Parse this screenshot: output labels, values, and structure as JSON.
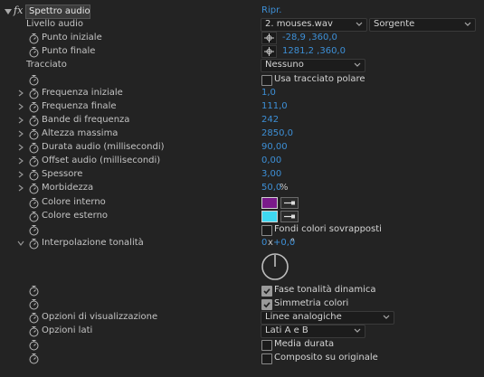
{
  "header": {
    "fx_label": "fx",
    "effect_name": "Spettro audio",
    "reset_label": "Ripr."
  },
  "livello_audio": {
    "label": "Livello audio",
    "layer_value": "2. mouses.wav",
    "source_value": "Sorgente"
  },
  "punto_iniziale": {
    "label": "Punto iniziale",
    "value": "-28,9 ,360,0"
  },
  "punto_finale": {
    "label": "Punto finale",
    "value": "1281,2 ,360,0"
  },
  "tracciato": {
    "label": "Tracciato",
    "value": "Nessuno"
  },
  "usa_tracciato_polare": {
    "label": "Usa tracciato polare",
    "checked": false
  },
  "frequenza_iniziale": {
    "label": "Frequenza iniziale",
    "value": "1,0"
  },
  "frequenza_finale": {
    "label": "Frequenza finale",
    "value": "111,0"
  },
  "bande_di_frequenza": {
    "label": "Bande di frequenza",
    "value": "242"
  },
  "altezza_massima": {
    "label": "Altezza massima",
    "value": "2850,0"
  },
  "durata_audio": {
    "label": "Durata audio (millisecondi)",
    "value": "90,00"
  },
  "offset_audio": {
    "label": "Offset audio (millisecondi)",
    "value": "0,00"
  },
  "spessore": {
    "label": "Spessore",
    "value": "3,00"
  },
  "morbidezza": {
    "label": "Morbidezza",
    "value": "50,0",
    "unit": "%"
  },
  "colore_interno": {
    "label": "Colore interno",
    "color": "#7a1a8a"
  },
  "colore_esterno": {
    "label": "Colore esterno",
    "color": "#3fd8f2"
  },
  "fondi_colori": {
    "label": "Fondi colori sovrapposti",
    "checked": false
  },
  "interpolazione_tonalita": {
    "label": "Interpolazione tonalità",
    "revolutions": "0",
    "sep": "x",
    "degrees": "+0,0",
    "deg_unit": "°",
    "angle_deg": 0
  },
  "fase_tonalita": {
    "label": "Fase tonalità dinamica",
    "checked": true
  },
  "simmetria_colori": {
    "label": "Simmetria colori",
    "checked": true
  },
  "opzioni_visualizzazione": {
    "label": "Opzioni di visualizzazione",
    "value": "Linee analogiche"
  },
  "opzioni_lati": {
    "label": "Opzioni lati",
    "value": "Lati A e B"
  },
  "media_durata": {
    "label": "Media durata",
    "checked": false
  },
  "composito_su_originale": {
    "label": "Composito su originale",
    "checked": false
  },
  "colors": {
    "panel_bg": "#232323",
    "value_blue": "#3d8fd6",
    "header_bg": "#3a3a3a"
  }
}
